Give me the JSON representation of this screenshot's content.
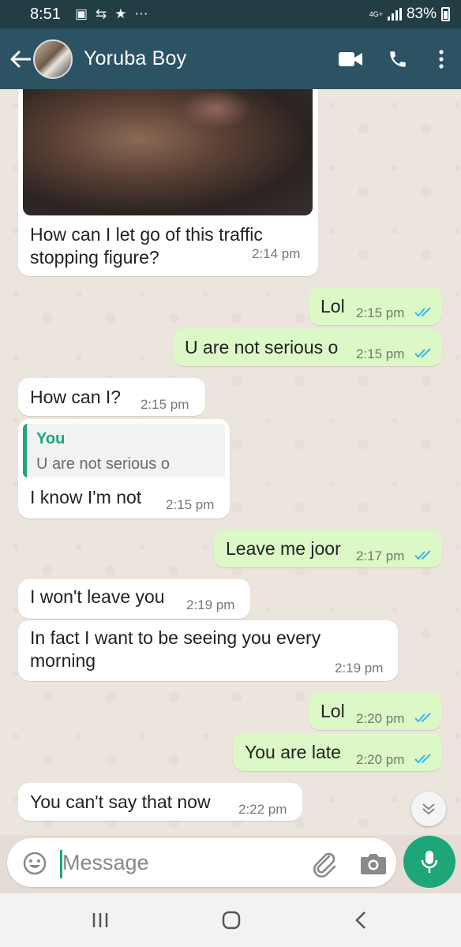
{
  "status_bar": {
    "time": "8:51",
    "network": "4G+",
    "battery": "83%"
  },
  "header": {
    "contact_name": "Yoruba Boy"
  },
  "messages": [
    {
      "direction": "in",
      "text_lines": [
        "How can I let go of this traffic",
        "stopping figure?"
      ],
      "time": "2:14 pm",
      "has_image": true
    },
    {
      "direction": "out",
      "text_lines": [
        "Lol"
      ],
      "time": "2:15 pm",
      "read": true
    },
    {
      "direction": "out",
      "text_lines": [
        "U are not serious o"
      ],
      "time": "2:15 pm",
      "read": true
    },
    {
      "direction": "in",
      "text_lines": [
        "How can I?"
      ],
      "time": "2:15 pm"
    },
    {
      "direction": "in",
      "quote": {
        "author": "You",
        "text": "U are not serious o"
      },
      "text_lines": [
        "I know I'm not"
      ],
      "time": "2:15 pm"
    },
    {
      "direction": "out",
      "text_lines": [
        "Leave me joor"
      ],
      "time": "2:17 pm",
      "read": true
    },
    {
      "direction": "in",
      "text_lines": [
        "I won't leave you"
      ],
      "time": "2:19 pm"
    },
    {
      "direction": "in",
      "text_lines": [
        "In fact I want to be seeing you every",
        "morning"
      ],
      "time": "2:19 pm"
    },
    {
      "direction": "out",
      "text_lines": [
        "Lol"
      ],
      "time": "2:20 pm",
      "read": true
    },
    {
      "direction": "out",
      "text_lines": [
        "You are late"
      ],
      "time": "2:20 pm",
      "read": true
    },
    {
      "direction": "in",
      "text_lines": [
        "You can't say that now"
      ],
      "time": "2:22 pm"
    }
  ],
  "input": {
    "placeholder": "Message"
  },
  "colors": {
    "header": "#2c5364",
    "status_bar": "#233d45",
    "accent": "#1fa57a",
    "outgoing_bubble": "#dcf8c6",
    "incoming_bubble": "#ffffff",
    "read_ticks": "#34b7f1"
  },
  "icons": [
    "back-arrow-icon",
    "video-call-icon",
    "phone-icon",
    "more-vert-icon",
    "emoji-icon",
    "attach-icon",
    "camera-icon",
    "mic-icon",
    "scroll-down-icon",
    "double-tick-icon",
    "recents-icon",
    "home-icon",
    "back-icon"
  ]
}
